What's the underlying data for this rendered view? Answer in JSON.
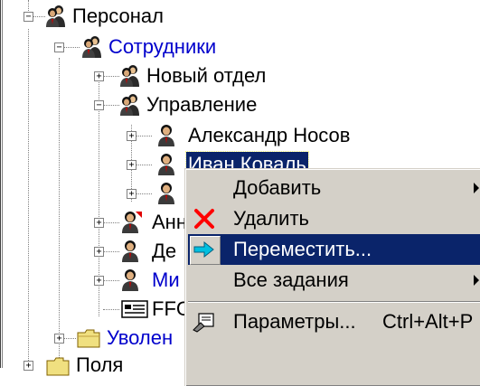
{
  "tree": {
    "root_partial_top": "",
    "nodes": [
      {
        "id": "personal",
        "label": "Персонал",
        "expander": "−",
        "icon": "people-group-icon",
        "color": "normal"
      },
      {
        "id": "employees",
        "label": "Сотрудники",
        "expander": "−",
        "icon": "people-group-icon",
        "color": "blue"
      },
      {
        "id": "new-dept",
        "label": "Новый отдел",
        "expander": "+",
        "icon": "people-group-icon",
        "color": "normal"
      },
      {
        "id": "management",
        "label": "Управление",
        "expander": "−",
        "icon": "people-group-icon",
        "color": "normal"
      },
      {
        "id": "nosov",
        "label": "Александр Носов",
        "expander": "+",
        "icon": "person-icon",
        "color": "normal"
      },
      {
        "id": "koval",
        "label": "Иван Коваль",
        "expander": "+",
        "icon": "person-icon",
        "color": "selected"
      },
      {
        "id": "hidden1",
        "label": "",
        "expander": "+",
        "icon": "person-icon",
        "color": "normal"
      },
      {
        "id": "ann",
        "label": "Анн",
        "expander": "+",
        "icon": "person-manager-icon",
        "color": "normal"
      },
      {
        "id": "de",
        "label": "Де",
        "expander": "+",
        "icon": "person-icon",
        "color": "normal"
      },
      {
        "id": "mi",
        "label": "Ми",
        "expander": "+",
        "icon": "person-icon",
        "color": "blue"
      },
      {
        "id": "ffc",
        "label": "FFC",
        "expander": "",
        "icon": "card-icon",
        "color": "normal"
      },
      {
        "id": "fired",
        "label": "Уволен",
        "expander": "+",
        "icon": "folder-icon",
        "color": "blue"
      },
      {
        "id": "bottom",
        "label": "Поля",
        "expander": "+",
        "icon": "folder-icon",
        "color": "normal"
      }
    ]
  },
  "context_menu": {
    "items": [
      {
        "label": "Добавить",
        "shortcut": "",
        "submenu": true,
        "icon": "",
        "highlighted": false
      },
      {
        "label": "Удалить",
        "shortcut": "",
        "submenu": false,
        "icon": "delete-x-icon",
        "highlighted": false
      },
      {
        "label": "Переместить...",
        "shortcut": "",
        "submenu": false,
        "icon": "move-arrow-icon",
        "highlighted": true
      },
      {
        "label": "Все задания",
        "shortcut": "",
        "submenu": true,
        "icon": "",
        "highlighted": false
      },
      {
        "separator": true
      },
      {
        "label": "Параметры...",
        "shortcut": "Ctrl+Alt+P",
        "submenu": false,
        "icon": "properties-icon",
        "highlighted": false
      }
    ]
  },
  "colors": {
    "selection_bg": "#0a246a",
    "link_blue": "#0000cc",
    "menu_bg": "#d4d0c8",
    "delete_red": "#ff0000",
    "move_cyan": "#00a0c0"
  }
}
